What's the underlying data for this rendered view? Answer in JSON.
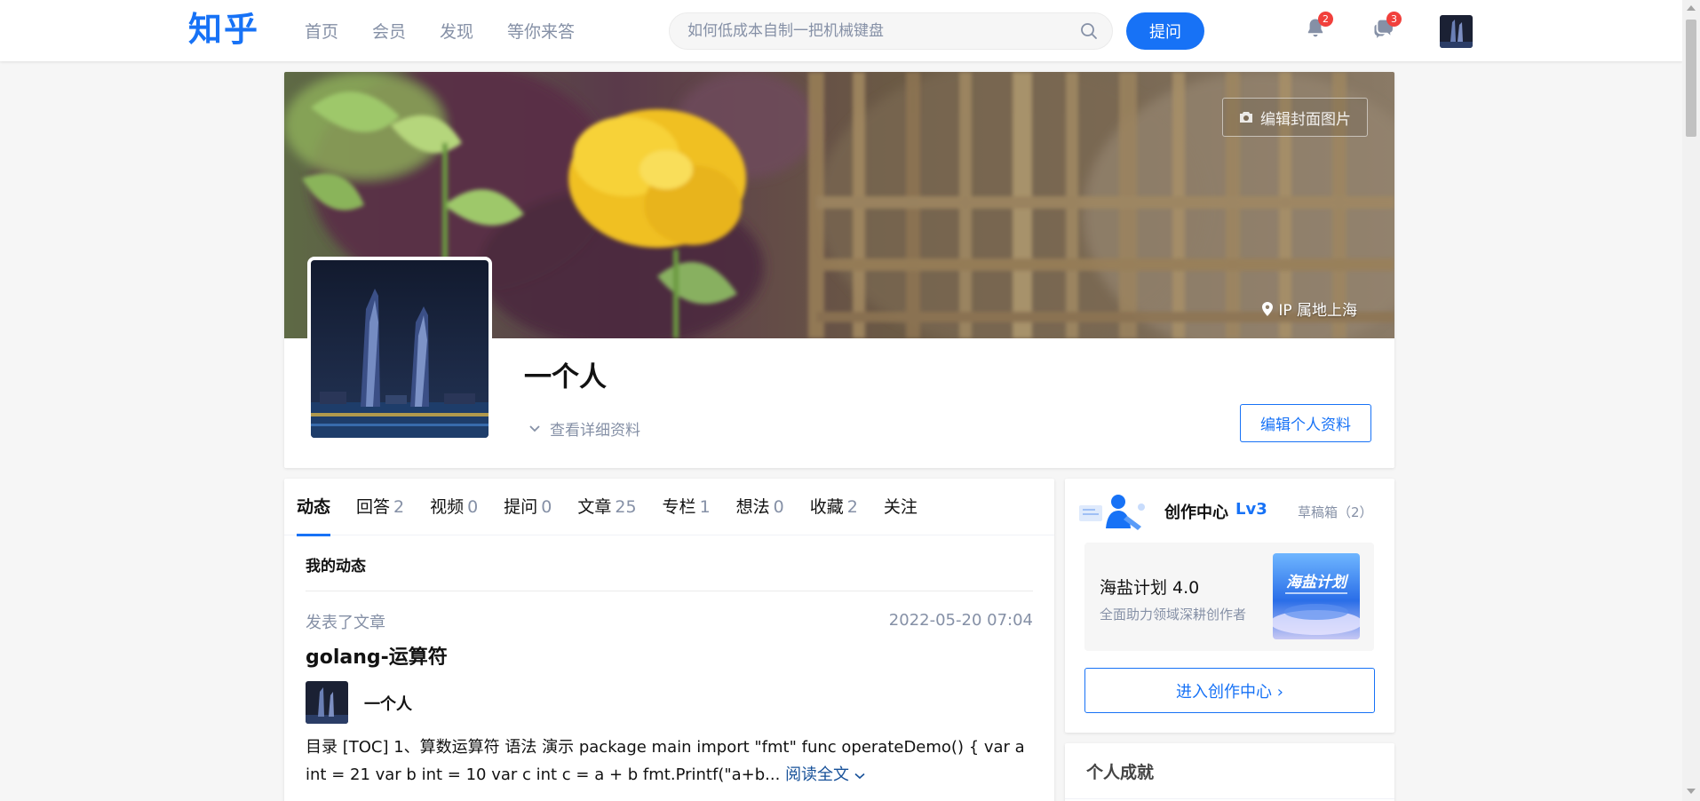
{
  "header": {
    "logo": "知乎",
    "nav": [
      "首页",
      "会员",
      "发现",
      "等你来答"
    ],
    "search_placeholder": "如何低成本自制一把机械键盘",
    "ask_label": "提问",
    "notifications_count": "2",
    "messages_count": "3"
  },
  "profile": {
    "edit_cover_label": "编辑封面图片",
    "ip_location": "IP 属地上海",
    "name": "一个人",
    "details_link": "查看详细资料",
    "edit_profile_label": "编辑个人资料"
  },
  "tabs": [
    {
      "label": "动态",
      "count": ""
    },
    {
      "label": "回答",
      "count": "2"
    },
    {
      "label": "视频",
      "count": "0"
    },
    {
      "label": "提问",
      "count": "0"
    },
    {
      "label": "文章",
      "count": "25"
    },
    {
      "label": "专栏",
      "count": "1"
    },
    {
      "label": "想法",
      "count": "0"
    },
    {
      "label": "收藏",
      "count": "2"
    },
    {
      "label": "关注",
      "count": ""
    }
  ],
  "feed": {
    "section_title": "我的动态",
    "action": "发表了文章",
    "time": "2022-05-20 07:04",
    "title": "golang-运算符",
    "author": "一个人",
    "excerpt": "目录 [TOC] 1、算数运算符 语法 演示 package main import \"fmt\" func operateDemo() { var a int = 21 var b int = 10 var c int c = a + b fmt.Printf(\"a+b...",
    "read_more": "阅读全文"
  },
  "creator": {
    "title": "创作中心",
    "level": "Lv3",
    "drafts": "草稿箱（2）",
    "program_title": "海盐计划 4.0",
    "program_subtitle": "全面助力领域深耕创作者",
    "program_image_text": "海盐计划",
    "enter_label": "进入创作中心"
  },
  "achievements": {
    "title": "个人成就"
  },
  "colors": {
    "brand": "#1772f6",
    "badge": "#f1403c",
    "muted": "#8590a6"
  }
}
